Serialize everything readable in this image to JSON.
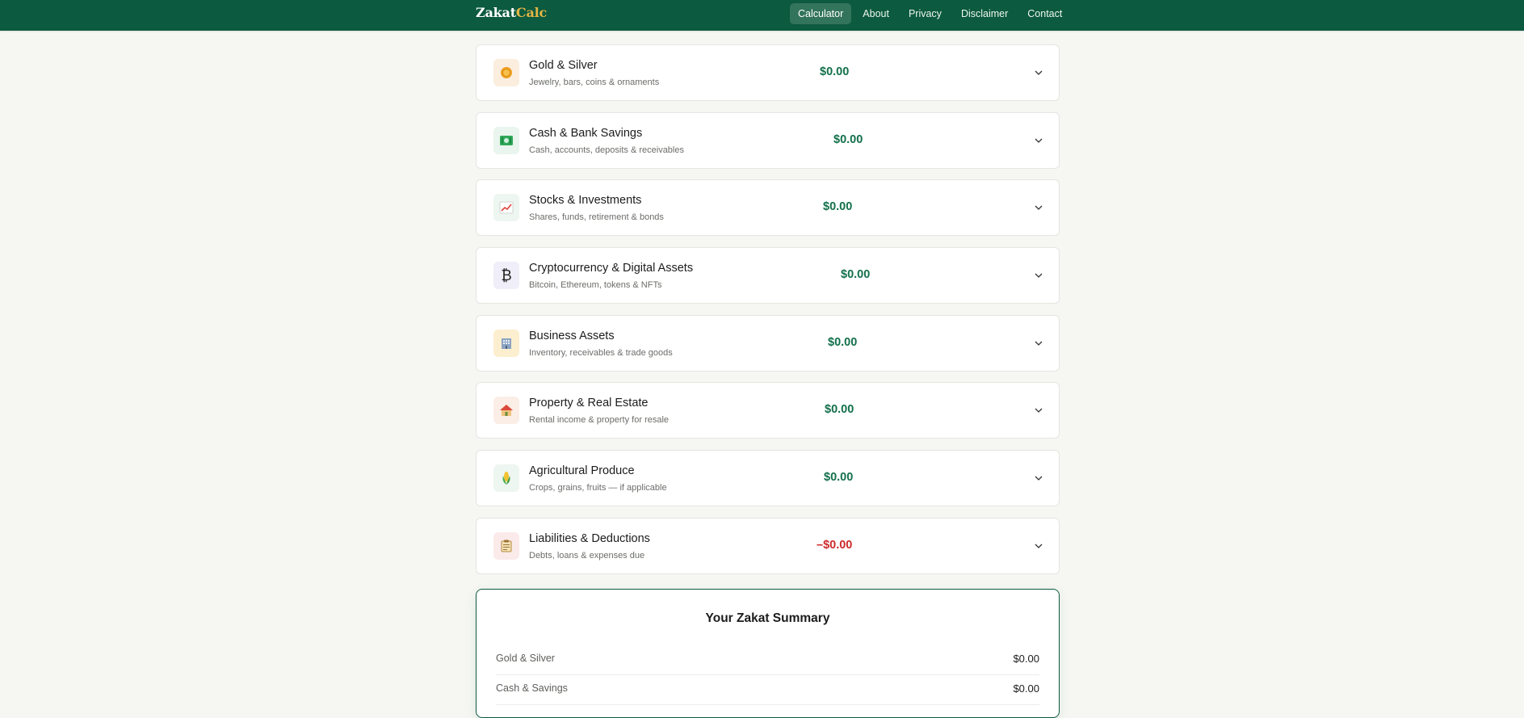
{
  "brand": {
    "part1": "Zakat",
    "part2": "Calc"
  },
  "nav": [
    {
      "label": "Calculator",
      "active": true
    },
    {
      "label": "About"
    },
    {
      "label": "Privacy"
    },
    {
      "label": "Disclaimer"
    },
    {
      "label": "Contact"
    }
  ],
  "categories": [
    {
      "title": "Gold & Silver",
      "subtitle": "Jewelry, bars, coins & ornaments",
      "amount": "$0.00",
      "icon": "coin-icon",
      "icon_bg": "#fbeede"
    },
    {
      "title": "Cash & Bank Savings",
      "subtitle": "Cash, accounts, deposits & receivables",
      "amount": "$0.00",
      "icon": "banknote-icon",
      "icon_bg": "#e9f5ee"
    },
    {
      "title": "Stocks & Investments",
      "subtitle": "Shares, funds, retirement & bonds",
      "amount": "$0.00",
      "icon": "chart-up-icon",
      "icon_bg": "#eef6f1"
    },
    {
      "title": "Cryptocurrency & Digital Assets",
      "subtitle": "Bitcoin, Ethereum, tokens & NFTs",
      "amount": "$0.00",
      "icon": "bitcoin-icon",
      "icon_bg": "#f0eef8"
    },
    {
      "title": "Business Assets",
      "subtitle": "Inventory, receivables & trade goods",
      "amount": "$0.00",
      "icon": "building-icon",
      "icon_bg": "#fcefcf"
    },
    {
      "title": "Property & Real Estate",
      "subtitle": "Rental income & property for resale",
      "amount": "$0.00",
      "icon": "house-icon",
      "icon_bg": "#fbeee6"
    },
    {
      "title": "Agricultural Produce",
      "subtitle": "Crops, grains, fruits — if applicable",
      "amount": "$0.00",
      "icon": "corn-icon",
      "icon_bg": "#eef6f1"
    },
    {
      "title": "Liabilities & Deductions",
      "subtitle": "Debts, loans & expenses due",
      "amount": "–$0.00",
      "icon": "clipboard-icon",
      "icon_bg": "#fbeaea"
    }
  ],
  "summary": {
    "title": "Your Zakat Summary",
    "rows": [
      {
        "label": "Gold & Silver",
        "value": "$0.00"
      },
      {
        "label": "Cash & Savings",
        "value": "$0.00"
      }
    ]
  },
  "colors": {
    "primary": "#0c5a3f",
    "accent": "#e2b544",
    "amount": "#13704b",
    "negative": "#cc2a2a"
  }
}
